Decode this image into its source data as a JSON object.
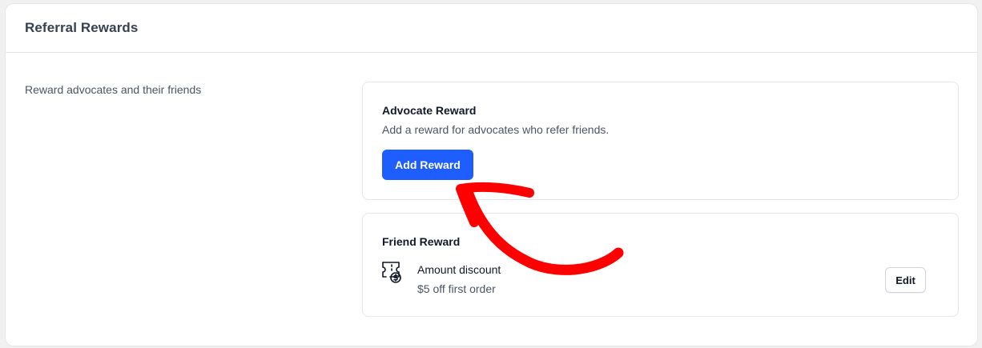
{
  "panel": {
    "title": "Referral Rewards",
    "description": "Reward advocates and their friends"
  },
  "advocate_card": {
    "title": "Advocate Reward",
    "subtitle": "Add a reward for advocates who refer friends.",
    "add_button_label": "Add Reward"
  },
  "friend_card": {
    "title": "Friend Reward",
    "reward": {
      "icon": "ticket-dollar-icon",
      "name": "Amount discount",
      "detail": "$5 off first order"
    },
    "edit_button_label": "Edit"
  },
  "colors": {
    "primary": "#1e5eff",
    "annotation_arrow": "#ff0000"
  },
  "annotation": {
    "type": "arrow",
    "points_to": "add-reward-button"
  }
}
